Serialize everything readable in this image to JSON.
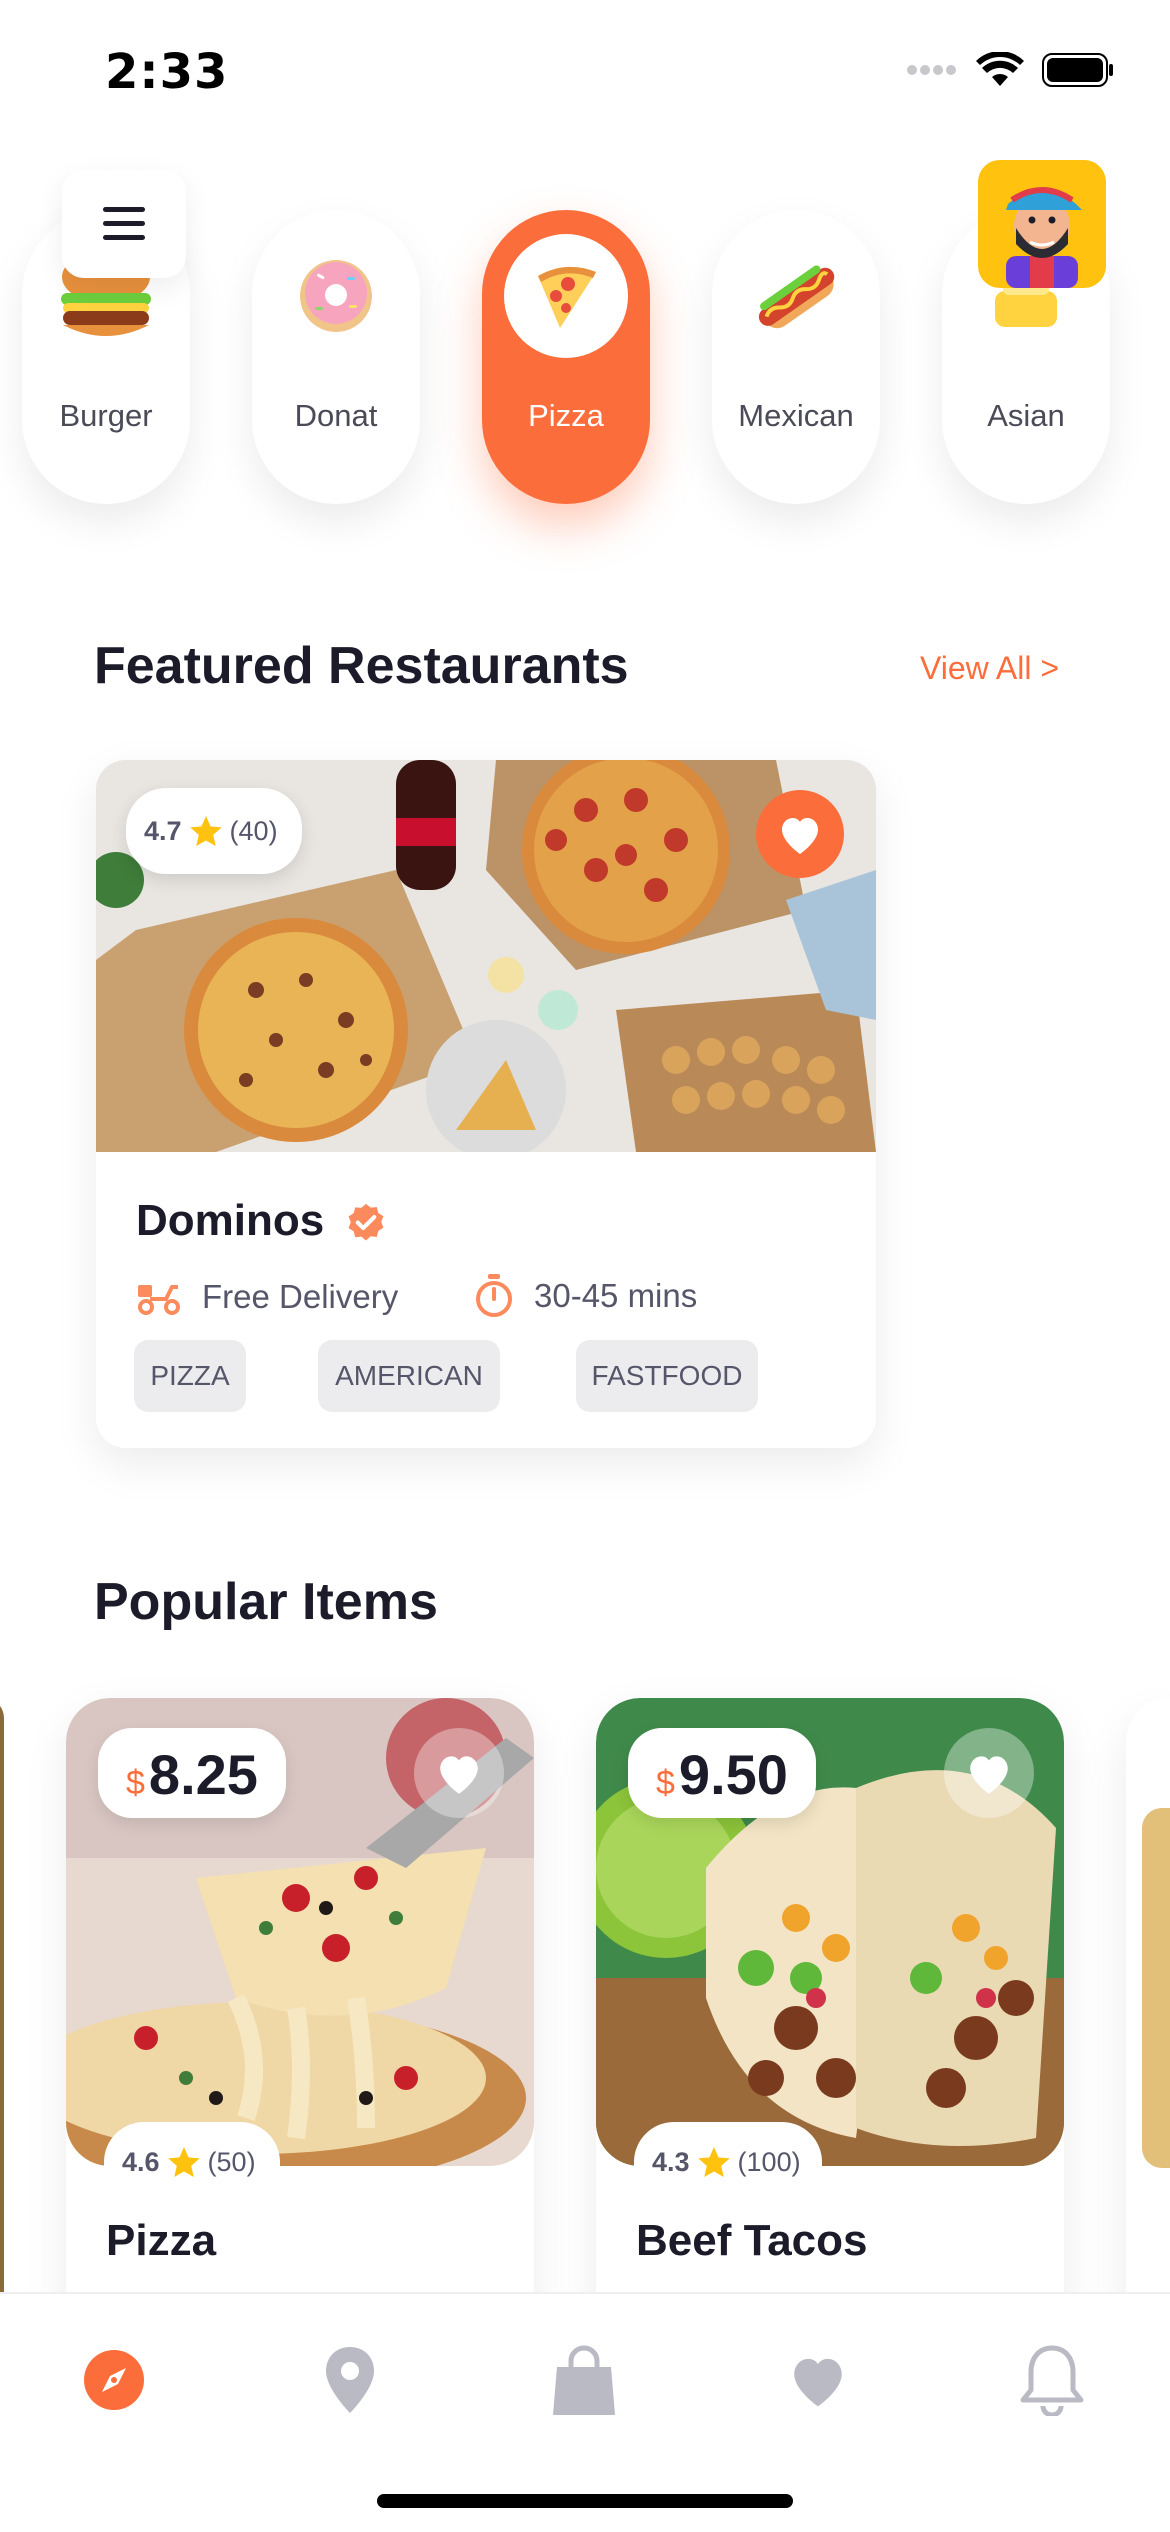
{
  "status_bar": {
    "time": "2:33"
  },
  "categories": [
    {
      "label": "Burger",
      "icon": "burger-icon"
    },
    {
      "label": "Donat",
      "icon": "donut-icon"
    },
    {
      "label": "Pizza",
      "icon": "pizza-icon",
      "active": true
    },
    {
      "label": "Mexican",
      "icon": "hotdog-icon"
    },
    {
      "label": "Asian",
      "icon": "asian-food-icon"
    }
  ],
  "featured": {
    "title": "Featured Restaurants",
    "view_all": "View All >",
    "card": {
      "rating": "4.7",
      "rating_count": "(40)",
      "name": "Dominos",
      "delivery": "Free Delivery",
      "time": "30-45 mins",
      "tags": [
        "PIZZA",
        "AMERICAN",
        "FASTFOOD"
      ]
    }
  },
  "popular": {
    "title": "Popular Items",
    "items": [
      {
        "currency": "$",
        "price": "8.25",
        "rating": "4.6",
        "rating_count": "(50)",
        "name": "Pizza"
      },
      {
        "currency": "$",
        "price": "9.50",
        "rating": "4.3",
        "rating_count": "(100)",
        "name": "Beef Tacos"
      }
    ]
  },
  "nav": [
    "explore-icon",
    "location-icon",
    "bag-icon",
    "heart-icon",
    "bell-icon"
  ],
  "colors": {
    "accent": "#fb6d3a",
    "star": "#ffc20e",
    "text": "#1b1b2a"
  }
}
